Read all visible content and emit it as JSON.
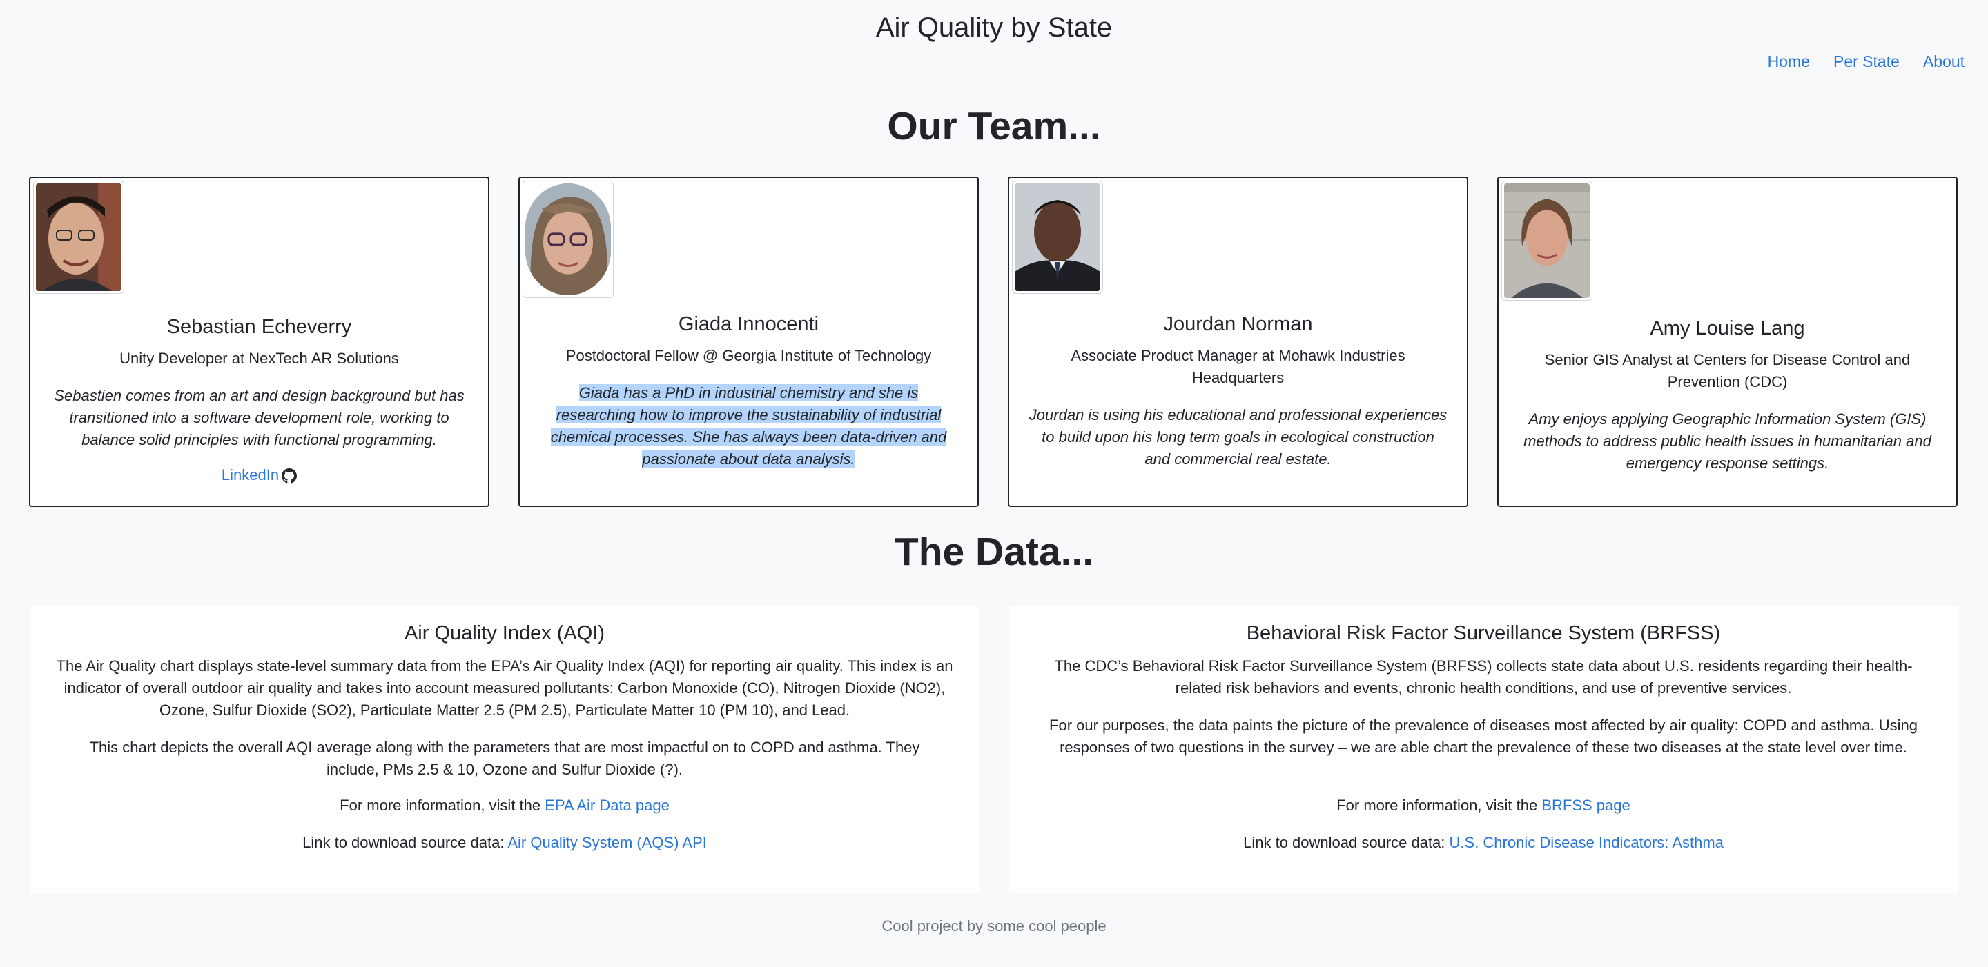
{
  "site": {
    "title": "Air Quality by State"
  },
  "nav": {
    "items": [
      {
        "label": "Home"
      },
      {
        "label": "Per State"
      },
      {
        "label": "About"
      }
    ]
  },
  "team": {
    "heading": "Our Team...",
    "members": [
      {
        "name": "Sebastian Echeverry",
        "role": "Unity Developer at NexTech AR Solutions",
        "bio": "Sebastien comes from an art and design background but has transitioned into a software development role, working to balance solid principles with functional programming.",
        "link_label": "LinkedIn",
        "link_icon": "github-icon"
      },
      {
        "name": "Giada Innocenti",
        "role": "Postdoctoral Fellow @ Georgia Institute of Technology",
        "bio": "Giada has a PhD in industrial chemistry and she is researching how to improve the sustainability of industrial chemical processes. She has always been data-driven and passionate about data analysis."
      },
      {
        "name": "Jourdan Norman",
        "role": "Associate Product Manager at Mohawk Industries Headquarters",
        "bio": "Jourdan is using his educational and professional experiences to build upon his long term goals in ecological construction and commercial real estate."
      },
      {
        "name": "Amy Louise Lang",
        "role": "Senior GIS Analyst at Centers for Disease Control and Prevention (CDC)",
        "bio": "Amy enjoys applying Geographic Information System (GIS) methods to address public health issues in humanitarian and emergency response settings."
      }
    ]
  },
  "data_section": {
    "heading": "The Data...",
    "aqi": {
      "title": "Air Quality Index (AQI)",
      "p1": "The Air Quality chart displays state-level summary data from the EPA’s Air Quality Index (AQI) for reporting air quality. This index is an indicator of overall outdoor air quality and takes into account measured pollutants: Carbon Monoxide (CO), Nitrogen Dioxide (NO2), Ozone, Sulfur Dioxide (SO2), Particulate Matter 2.5 (PM 2.5), Particulate Matter 10 (PM 10), and Lead.",
      "p2": "This chart depicts the overall AQI average along with the parameters that are most impactful on to COPD and asthma. They include, PMs 2.5 & 10, Ozone and Sulfur Dioxide (?).",
      "more_prefix": "For more information, visit the ",
      "more_link": "EPA Air Data page",
      "download_prefix": "Link to download source data: ",
      "download_link": "Air Quality System (AQS) API"
    },
    "brfss": {
      "title": "Behavioral Risk Factor Surveillance System (BRFSS)",
      "p1": "The CDC’s Behavioral Risk Factor Surveillance System (BRFSS) collects state data about U.S. residents regarding their health-related risk behaviors and events, chronic health conditions, and use of preventive services.",
      "p2": "For our purposes, the data paints the picture of the prevalence of diseases most affected by air quality: COPD and asthma. Using responses of two questions in the survey – we are able chart the prevalence of these two diseases at the state level over time.",
      "more_prefix": "For more information, visit the ",
      "more_link": "BRFSS page",
      "download_prefix": "Link to download source data: ",
      "download_link": "U.S. Chronic Disease Indicators: Asthma"
    }
  },
  "footer": {
    "text": "Cool project by some cool people"
  }
}
